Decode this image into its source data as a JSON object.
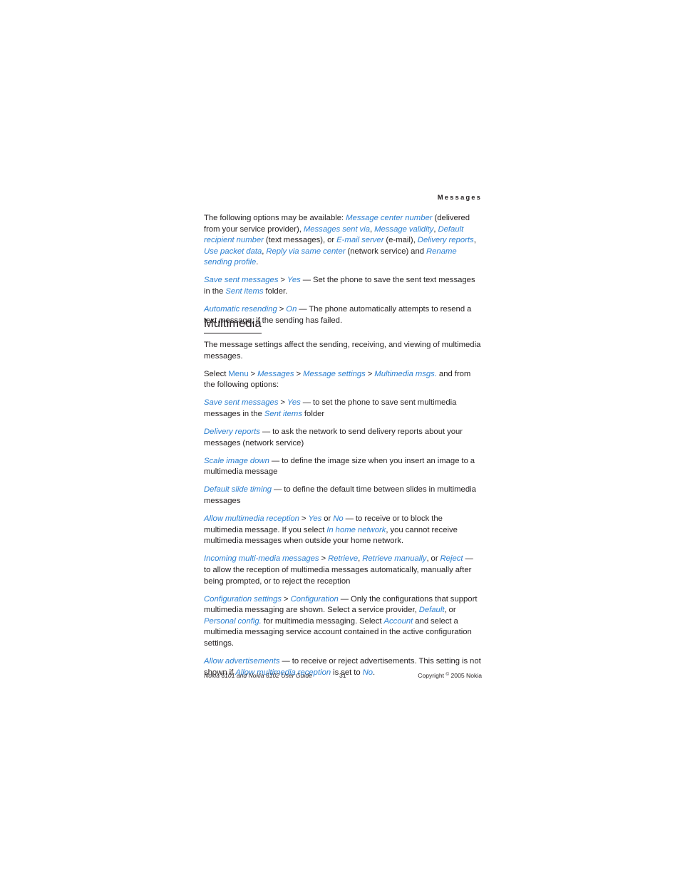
{
  "header": {
    "running_head": "Messages"
  },
  "body": {
    "paragraphs": [
      {
        "id": "p-options-available",
        "runs": [
          {
            "t": "The following options may be available: ",
            "s": "plain"
          },
          {
            "t": "Message center number",
            "s": "ui"
          },
          {
            "t": " (delivered from your service provider), ",
            "s": "plain"
          },
          {
            "t": "Messages sent via",
            "s": "ui"
          },
          {
            "t": ", ",
            "s": "plain"
          },
          {
            "t": "Message validity",
            "s": "ui"
          },
          {
            "t": ", ",
            "s": "plain"
          },
          {
            "t": "Default recipient number",
            "s": "ui"
          },
          {
            "t": " (text messages), or ",
            "s": "plain"
          },
          {
            "t": "E-mail server",
            "s": "ui"
          },
          {
            "t": " (e-mail), ",
            "s": "plain"
          },
          {
            "t": "Delivery reports",
            "s": "ui"
          },
          {
            "t": ", ",
            "s": "plain"
          },
          {
            "t": "Use packet data",
            "s": "ui"
          },
          {
            "t": ", ",
            "s": "plain"
          },
          {
            "t": "Reply via same center",
            "s": "ui"
          },
          {
            "t": " (network service) and ",
            "s": "plain"
          },
          {
            "t": "Rename sending profile",
            "s": "ui"
          },
          {
            "t": ".",
            "s": "plain"
          }
        ]
      },
      {
        "id": "p-save-sent-messages-text",
        "runs": [
          {
            "t": "Save sent messages",
            "s": "ui"
          },
          {
            "t": " > ",
            "s": "plain"
          },
          {
            "t": "Yes",
            "s": "ui"
          },
          {
            "t": " — Set the phone to save the sent text messages in the ",
            "s": "plain"
          },
          {
            "t": "Sent items",
            "s": "ui"
          },
          {
            "t": " folder.",
            "s": "plain"
          }
        ]
      },
      {
        "id": "p-automatic-resending",
        "runs": [
          {
            "t": "Automatic resending",
            "s": "ui"
          },
          {
            "t": " > ",
            "s": "plain"
          },
          {
            "t": "On",
            "s": "ui"
          },
          {
            "t": " — The phone automatically attempts to resend a text message, if the sending has failed.",
            "s": "plain"
          }
        ]
      }
    ]
  },
  "section": {
    "heading": "Multimedia",
    "paragraphs": [
      {
        "id": "p-message-settings-affect",
        "runs": [
          {
            "t": "The message settings affect the sending, receiving, and viewing of multimedia messages.",
            "s": "plain"
          }
        ]
      },
      {
        "id": "p-select-path",
        "runs": [
          {
            "t": "Select ",
            "s": "plain"
          },
          {
            "t": "Menu",
            "s": "ui-up"
          },
          {
            "t": " > ",
            "s": "plain"
          },
          {
            "t": "Messages",
            "s": "ui"
          },
          {
            "t": " > ",
            "s": "plain"
          },
          {
            "t": "Message settings",
            "s": "ui"
          },
          {
            "t": " > ",
            "s": "plain"
          },
          {
            "t": "Multimedia msgs.",
            "s": "ui"
          },
          {
            "t": " and from the following options:",
            "s": "plain"
          }
        ]
      },
      {
        "id": "p-save-sent-messages-mms",
        "runs": [
          {
            "t": "Save sent messages",
            "s": "ui"
          },
          {
            "t": " > ",
            "s": "plain"
          },
          {
            "t": "Yes",
            "s": "ui"
          },
          {
            "t": " — to set the phone to save sent multimedia messages in the ",
            "s": "plain"
          },
          {
            "t": "Sent items",
            "s": "ui"
          },
          {
            "t": " folder",
            "s": "plain"
          }
        ]
      },
      {
        "id": "p-delivery-reports",
        "runs": [
          {
            "t": "Delivery reports",
            "s": "ui"
          },
          {
            "t": " — to ask the network to send delivery reports about your messages (network service)",
            "s": "plain"
          }
        ]
      },
      {
        "id": "p-scale-image-down",
        "runs": [
          {
            "t": "Scale image down",
            "s": "ui"
          },
          {
            "t": " — to define the image size when you insert an image to a multimedia message",
            "s": "plain"
          }
        ]
      },
      {
        "id": "p-default-slide-timing",
        "runs": [
          {
            "t": "Default slide timing",
            "s": "ui"
          },
          {
            "t": " — to define the default time between slides in multimedia messages",
            "s": "plain"
          }
        ]
      },
      {
        "id": "p-allow-multimedia-reception",
        "runs": [
          {
            "t": "Allow multimedia reception",
            "s": "ui"
          },
          {
            "t": " > ",
            "s": "plain"
          },
          {
            "t": "Yes",
            "s": "ui"
          },
          {
            "t": " or ",
            "s": "plain"
          },
          {
            "t": "No",
            "s": "ui"
          },
          {
            "t": " — to receive or to block the multimedia message. If you select ",
            "s": "plain"
          },
          {
            "t": "In home network",
            "s": "ui"
          },
          {
            "t": ", you cannot receive multimedia messages when outside your home network.",
            "s": "plain"
          }
        ]
      },
      {
        "id": "p-incoming-multi-media-messages",
        "runs": [
          {
            "t": "Incoming multi-media messages",
            "s": "ui"
          },
          {
            "t": " > ",
            "s": "plain"
          },
          {
            "t": "Retrieve",
            "s": "ui"
          },
          {
            "t": ", ",
            "s": "plain"
          },
          {
            "t": "Retrieve manually",
            "s": "ui"
          },
          {
            "t": ", or ",
            "s": "plain"
          },
          {
            "t": "Reject",
            "s": "ui"
          },
          {
            "t": " — to allow the reception of multimedia messages automatically, manually after being prompted, or to reject the reception",
            "s": "plain"
          }
        ]
      },
      {
        "id": "p-configuration-settings",
        "runs": [
          {
            "t": "Configuration settings",
            "s": "ui"
          },
          {
            "t": " > ",
            "s": "plain"
          },
          {
            "t": "Configuration",
            "s": "ui"
          },
          {
            "t": " — Only the configurations that support multimedia messaging are shown. Select a service provider, ",
            "s": "plain"
          },
          {
            "t": "Default",
            "s": "ui"
          },
          {
            "t": ", or ",
            "s": "plain"
          },
          {
            "t": "Personal config.",
            "s": "ui"
          },
          {
            "t": " for multimedia messaging. Select ",
            "s": "plain"
          },
          {
            "t": "Account",
            "s": "ui"
          },
          {
            "t": " and select a multimedia messaging service account contained in the active configuration settings.",
            "s": "plain"
          }
        ]
      },
      {
        "id": "p-allow-advertisements",
        "runs": [
          {
            "t": "Allow advertisements",
            "s": "ui"
          },
          {
            "t": " — to receive or reject advertisements. This setting is not shown if ",
            "s": "plain"
          },
          {
            "t": "Allow multimedia reception",
            "s": "ui"
          },
          {
            "t": " is set to ",
            "s": "plain"
          },
          {
            "t": "No",
            "s": "ui"
          },
          {
            "t": ".",
            "s": "plain"
          }
        ]
      }
    ]
  },
  "footer": {
    "guide": "Nokia 6101 and Nokia 6102 User Guide",
    "page_number": "31",
    "copyright_prefix": "Copyright ",
    "copyright_symbol": "©",
    "copyright_suffix": " 2005 Nokia"
  },
  "colors": {
    "ui_blue": "#2b7fd0",
    "text_black": "#231f20",
    "page_background": "#ffffff"
  }
}
